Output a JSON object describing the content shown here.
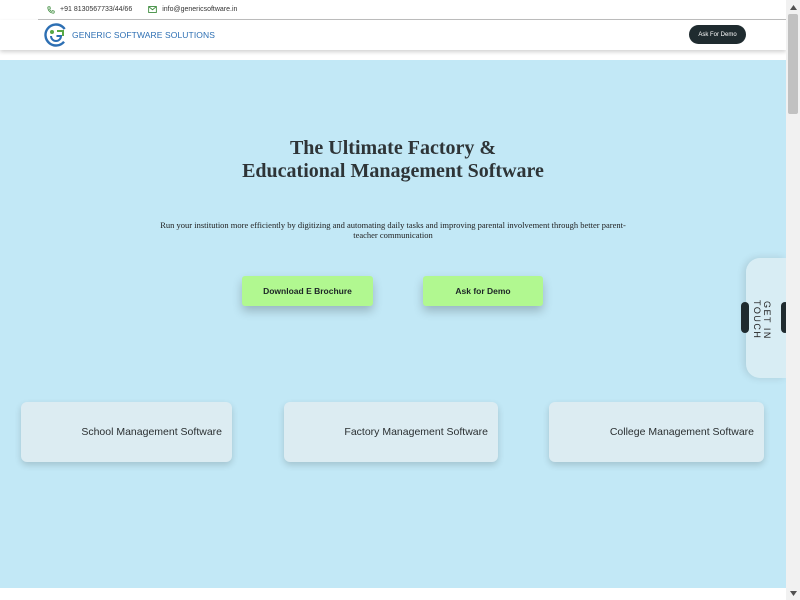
{
  "contact": {
    "phone": "+91 8130567733/44/66",
    "email": "info@genericsoftware.in"
  },
  "header": {
    "brand": "GENERIC SOFTWARE SOLUTIONS",
    "demo_button": "Ask For Demo"
  },
  "hero": {
    "title_line1": "The Ultimate Factory &",
    "title_line2": "Educational Management Software",
    "subtitle": "Run your institution more efficiently by digitizing and automating daily tasks and improving parental involvement through better parent-teacher communication",
    "buttons": {
      "brochure": "Download E Brochure",
      "demo": "Ask for Demo"
    }
  },
  "cards": [
    {
      "label": "School Management Software"
    },
    {
      "label": "Factory Management Software"
    },
    {
      "label": "College Management Software"
    }
  ],
  "side_tab": {
    "label": "GET IN TOUCH"
  },
  "icons": {
    "phone": "phone-icon",
    "email": "email-icon",
    "logo": "logo-icon",
    "scroll_up": "chevron-up-icon",
    "scroll_down": "chevron-down-icon"
  },
  "colors": {
    "hero_background": "#c2e8f6",
    "cta_green": "#b1f890",
    "dark_button": "#1f2b2f",
    "brand_blue": "#2d6fb3",
    "card_background": "#dcecf2"
  }
}
